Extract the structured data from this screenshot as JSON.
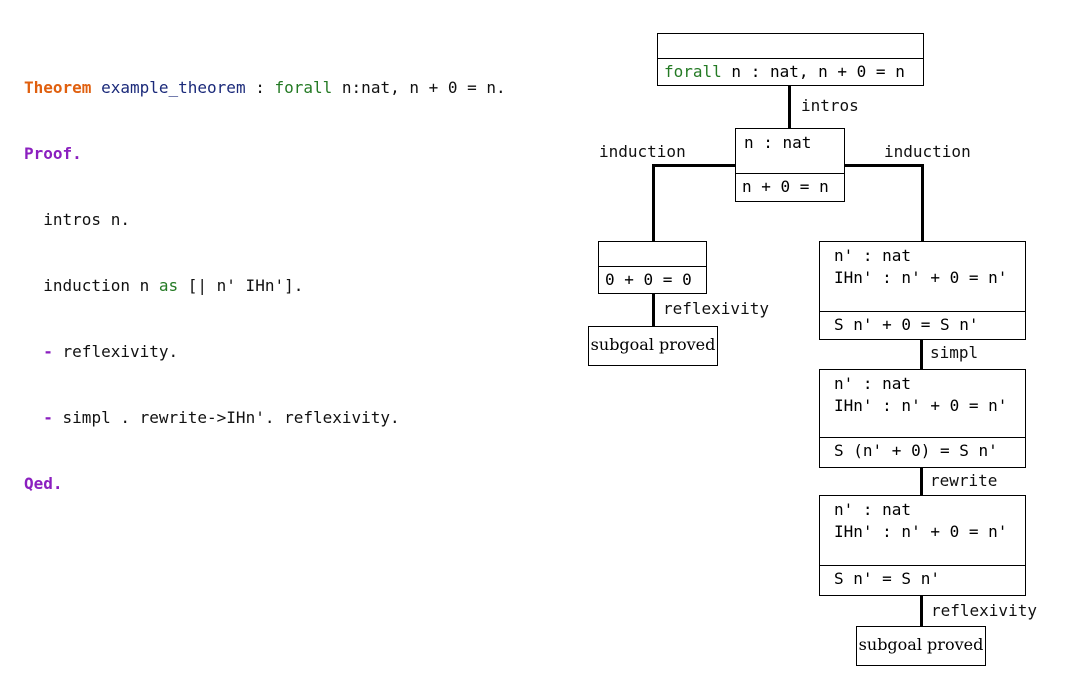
{
  "code": {
    "theorem_kw": "Theorem",
    "theorem_name": "example_theorem",
    "theorem_colon": " : ",
    "theorem_forall": "forall",
    "theorem_stmt": " n:nat, n + 0 = n.",
    "proof_kw": "Proof.",
    "line_intros": "  intros n.",
    "line_induction_a": "  induction n ",
    "line_induction_as": "as",
    "line_induction_b": " [| n' IHn'].",
    "bullet": "  -",
    "line_refl": " reflexivity.",
    "line_simpl": " simpl . rewrite->IHn'. reflexivity.",
    "qed_kw": "Qed."
  },
  "tree": {
    "root": {
      "hyp": "",
      "goal_forall": "forall",
      "goal_rest": " n : nat, n + 0 = n"
    },
    "intros_label": "intros",
    "n1": {
      "hyp": "n : nat",
      "goal": "n + 0 = n"
    },
    "induction_left_label": "induction",
    "induction_right_label": "induction",
    "base": {
      "hyp": "",
      "goal": "0 + 0 = 0"
    },
    "base_tactic": "reflexivity",
    "base_done": "subgoal proved",
    "s1": {
      "hyp": "n' : nat\nIHn' : n' + 0 = n'",
      "goal": "S n' + 0 = S n'"
    },
    "simpl_label": "simpl",
    "s2": {
      "hyp": "n' : nat\nIHn' : n' + 0 = n'",
      "goal": "S (n' + 0) = S n'"
    },
    "rewrite_label": "rewrite",
    "s3": {
      "hyp": "n' : nat\nIHn' : n' + 0 = n'",
      "goal": "S n' = S n'"
    },
    "step_tactic": "reflexivity",
    "step_done": "subgoal proved"
  },
  "colors": {
    "keyword_orange": "#e0600f",
    "keyword_purple": "#8b1fbf",
    "name_navy": "#1b2a7a",
    "forall_green": "#247a24"
  }
}
